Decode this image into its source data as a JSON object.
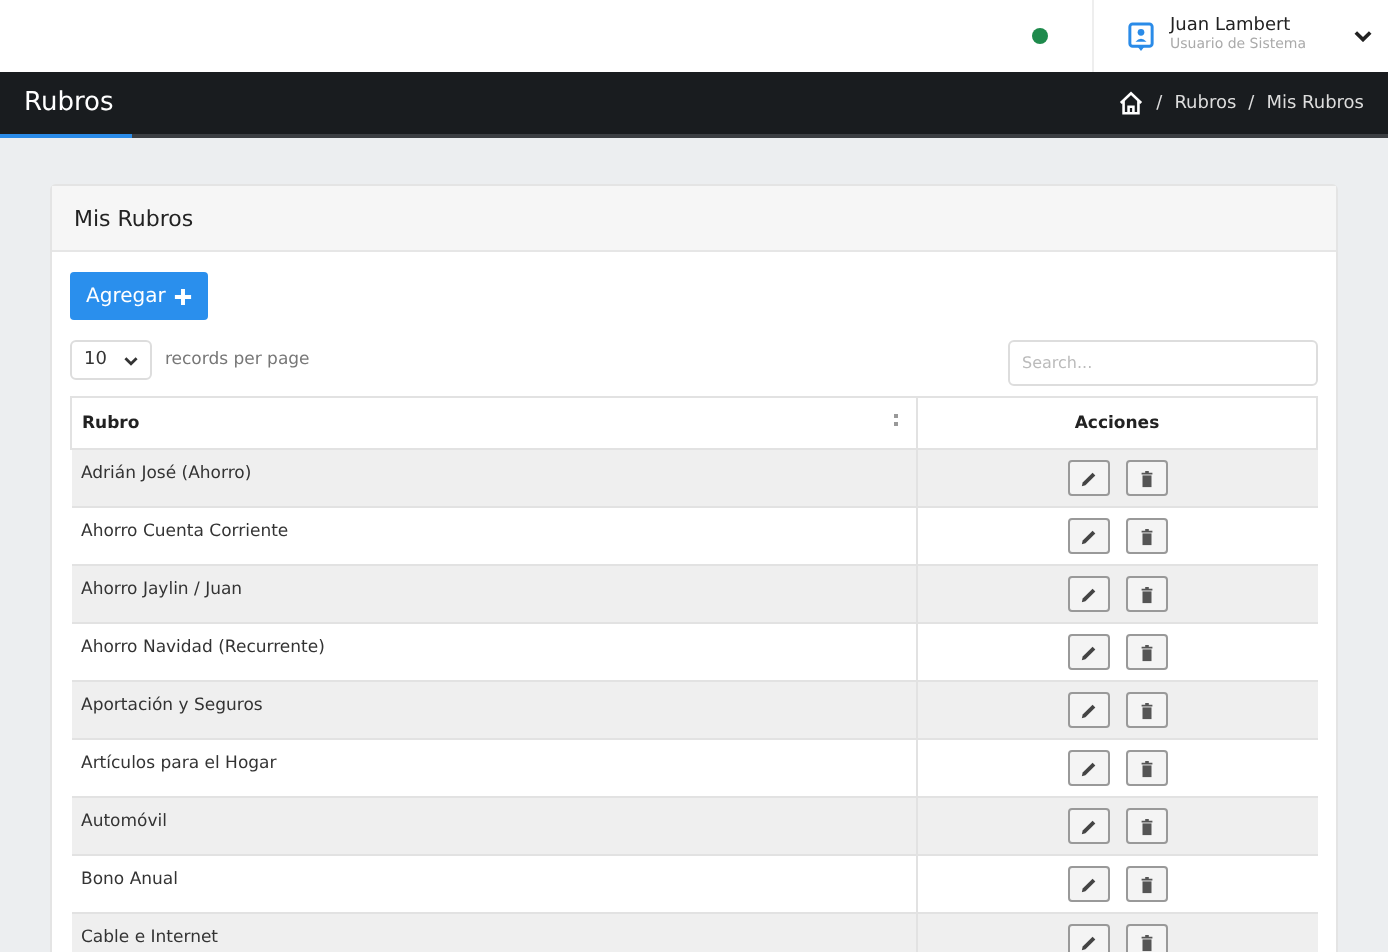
{
  "topbar": {
    "online": true,
    "user": {
      "name": "Juan Lambert",
      "role": "Usuario de Sistema"
    }
  },
  "header": {
    "title": "Rubros",
    "breadcrumb": [
      {
        "separator": "/",
        "label": "Rubros"
      },
      {
        "separator": "/",
        "label": "Mis Rubros"
      }
    ]
  },
  "card": {
    "title": "Mis Rubros",
    "add_button": "Agregar",
    "page_size": "10",
    "page_size_label": "records per page",
    "search": {
      "placeholder": "Search..."
    },
    "table": {
      "columns": [
        "Rubro",
        "Acciones"
      ],
      "rows": [
        {
          "rubro": "Adrián José (Ahorro)"
        },
        {
          "rubro": "Ahorro Cuenta Corriente"
        },
        {
          "rubro": "Ahorro Jaylin / Juan"
        },
        {
          "rubro": "Ahorro Navidad (Recurrente)"
        },
        {
          "rubro": "Aportación y Seguros"
        },
        {
          "rubro": "Artículos para el Hogar"
        },
        {
          "rubro": "Automóvil"
        },
        {
          "rubro": "Bono Anual"
        },
        {
          "rubro": "Cable e Internet"
        }
      ]
    }
  }
}
